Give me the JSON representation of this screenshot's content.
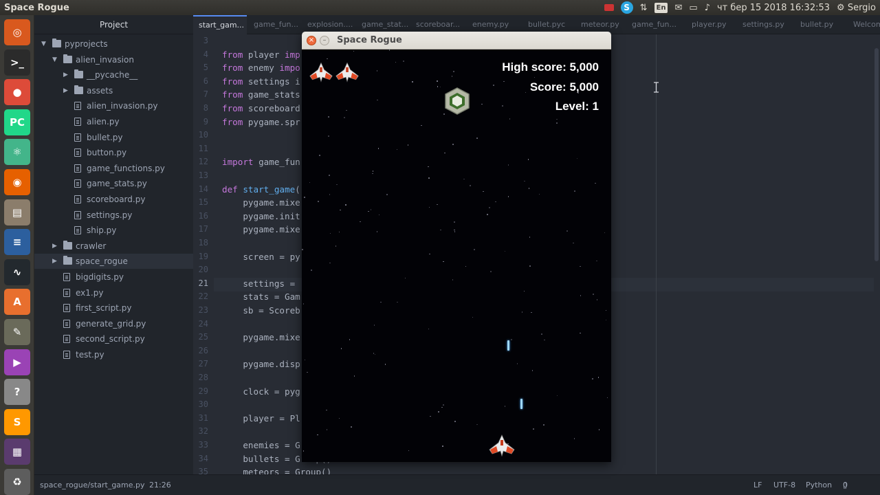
{
  "topbar": {
    "app_title": "Space Rogue",
    "lang": "En",
    "skype": "S",
    "volume_icon": "volume-icon",
    "datetime": "чт бер 15 2018 16:32:53",
    "user": "Sergio"
  },
  "sidebar": {
    "header": "Project",
    "items": [
      {
        "label": "pyprojects",
        "kind": "folder",
        "depth": 0,
        "expanded": true
      },
      {
        "label": "alien_invasion",
        "kind": "folder",
        "depth": 1,
        "expanded": true
      },
      {
        "label": "__pycache__",
        "kind": "folder",
        "depth": 2,
        "expanded": false
      },
      {
        "label": "assets",
        "kind": "folder",
        "depth": 2,
        "expanded": false
      },
      {
        "label": "alien_invasion.py",
        "kind": "file",
        "depth": 2
      },
      {
        "label": "alien.py",
        "kind": "file",
        "depth": 2
      },
      {
        "label": "bullet.py",
        "kind": "file",
        "depth": 2
      },
      {
        "label": "button.py",
        "kind": "file",
        "depth": 2
      },
      {
        "label": "game_functions.py",
        "kind": "file",
        "depth": 2
      },
      {
        "label": "game_stats.py",
        "kind": "file",
        "depth": 2
      },
      {
        "label": "scoreboard.py",
        "kind": "file",
        "depth": 2
      },
      {
        "label": "settings.py",
        "kind": "file",
        "depth": 2
      },
      {
        "label": "ship.py",
        "kind": "file",
        "depth": 2
      },
      {
        "label": "crawler",
        "kind": "folder",
        "depth": 1,
        "expanded": false
      },
      {
        "label": "space_rogue",
        "kind": "folder",
        "depth": 1,
        "expanded": false,
        "selected": true
      },
      {
        "label": "bigdigits.py",
        "kind": "file",
        "depth": 1
      },
      {
        "label": "ex1.py",
        "kind": "file",
        "depth": 1
      },
      {
        "label": "first_script.py",
        "kind": "file",
        "depth": 1
      },
      {
        "label": "generate_grid.py",
        "kind": "file",
        "depth": 1
      },
      {
        "label": "second_script.py",
        "kind": "file",
        "depth": 1
      },
      {
        "label": "test.py",
        "kind": "file",
        "depth": 1
      }
    ]
  },
  "tabs": [
    {
      "label": "start_gam...",
      "active": true
    },
    {
      "label": "game_fun..."
    },
    {
      "label": "explosion...."
    },
    {
      "label": "game_stat..."
    },
    {
      "label": "scoreboar..."
    },
    {
      "label": "enemy.py"
    },
    {
      "label": "bullet.pyc"
    },
    {
      "label": "meteor.py"
    },
    {
      "label": "game_fun..."
    },
    {
      "label": "player.py"
    },
    {
      "label": "settings.py"
    },
    {
      "label": "bullet.py"
    },
    {
      "label": "Welcom"
    }
  ],
  "editor": {
    "current_line": "21",
    "lines": [
      {
        "n": "3",
        "code": []
      },
      {
        "n": "4",
        "code": [
          [
            "kw",
            "from"
          ],
          [
            "t",
            " player "
          ],
          [
            "kw",
            "imp"
          ]
        ]
      },
      {
        "n": "5",
        "code": [
          [
            "kw",
            "from"
          ],
          [
            "t",
            " enemy "
          ],
          [
            "kw",
            "impo"
          ]
        ]
      },
      {
        "n": "6",
        "code": [
          [
            "kw",
            "from"
          ],
          [
            "t",
            " settings i"
          ]
        ]
      },
      {
        "n": "7",
        "code": [
          [
            "kw",
            "from"
          ],
          [
            "t",
            " game_stats"
          ]
        ]
      },
      {
        "n": "8",
        "code": [
          [
            "kw",
            "from"
          ],
          [
            "t",
            " scoreboard"
          ]
        ]
      },
      {
        "n": "9",
        "code": [
          [
            "kw",
            "from"
          ],
          [
            "t",
            " pygame.spr"
          ]
        ]
      },
      {
        "n": "10",
        "code": []
      },
      {
        "n": "11",
        "code": []
      },
      {
        "n": "12",
        "code": [
          [
            "kw",
            "import"
          ],
          [
            "t",
            " game_fun"
          ]
        ]
      },
      {
        "n": "13",
        "code": []
      },
      {
        "n": "14",
        "code": [
          [
            "kw",
            "def"
          ],
          [
            "t",
            " "
          ],
          [
            "fn",
            "start_game"
          ],
          [
            "t",
            "("
          ]
        ]
      },
      {
        "n": "15",
        "code": [
          [
            "t",
            "    pygame.mixe"
          ]
        ]
      },
      {
        "n": "16",
        "code": [
          [
            "t",
            "    pygame.init"
          ]
        ]
      },
      {
        "n": "17",
        "code": [
          [
            "t",
            "    pygame.mixe"
          ]
        ]
      },
      {
        "n": "18",
        "code": []
      },
      {
        "n": "19",
        "code": [
          [
            "t",
            "    screen = py"
          ]
        ]
      },
      {
        "n": "20",
        "code": []
      },
      {
        "n": "21",
        "code": [
          [
            "t",
            "    settings = "
          ]
        ]
      },
      {
        "n": "22",
        "code": [
          [
            "t",
            "    stats = Gam"
          ]
        ]
      },
      {
        "n": "23",
        "code": [
          [
            "t",
            "    sb = Scoreb"
          ]
        ]
      },
      {
        "n": "24",
        "code": []
      },
      {
        "n": "25",
        "code": [
          [
            "t",
            "    pygame.mixe"
          ]
        ]
      },
      {
        "n": "26",
        "code": []
      },
      {
        "n": "27",
        "code": [
          [
            "t",
            "    pygame.disp"
          ]
        ]
      },
      {
        "n": "28",
        "code": []
      },
      {
        "n": "29",
        "code": [
          [
            "t",
            "    clock = pyg"
          ]
        ]
      },
      {
        "n": "30",
        "code": []
      },
      {
        "n": "31",
        "code": [
          [
            "t",
            "    player = Pl"
          ]
        ]
      },
      {
        "n": "32",
        "code": []
      },
      {
        "n": "33",
        "code": [
          [
            "t",
            "    enemies = G"
          ]
        ]
      },
      {
        "n": "34",
        "code": [
          [
            "t",
            "    bullets = Group()"
          ]
        ]
      },
      {
        "n": "35",
        "code": [
          [
            "t",
            "    meteors = Group()"
          ]
        ]
      }
    ]
  },
  "statusbar": {
    "file_path": "space_rogue/start_game.py",
    "cursor_pos": "21:26",
    "line_ending": "LF",
    "encoding": "UTF-8",
    "grammar": "Python",
    "git_files": "0 files"
  },
  "game": {
    "window_title": "Space Rogue",
    "high_score_text": "High score: 5,000",
    "score_text": "Score: 5,000",
    "level_text": "Level: 1",
    "lives": 2
  },
  "colors": {
    "editor_bg": "#282c34",
    "sidebar_bg": "#21252b",
    "keyword": "#c678dd",
    "function": "#61afef",
    "tab_accent": "#568af2",
    "game_bg": "#020206"
  },
  "launcher_icons": [
    "dash-icon",
    "terminal-icon",
    "chrome-icon",
    "pycharm-icon",
    "atom-icon",
    "firefox-icon",
    "files-icon",
    "writer-icon",
    "system-monitor-icon",
    "software-center-icon",
    "gimp-icon",
    "screen-recorder-icon",
    "help-icon",
    "sublime-icon",
    "workspace-icon",
    "trash-icon"
  ]
}
